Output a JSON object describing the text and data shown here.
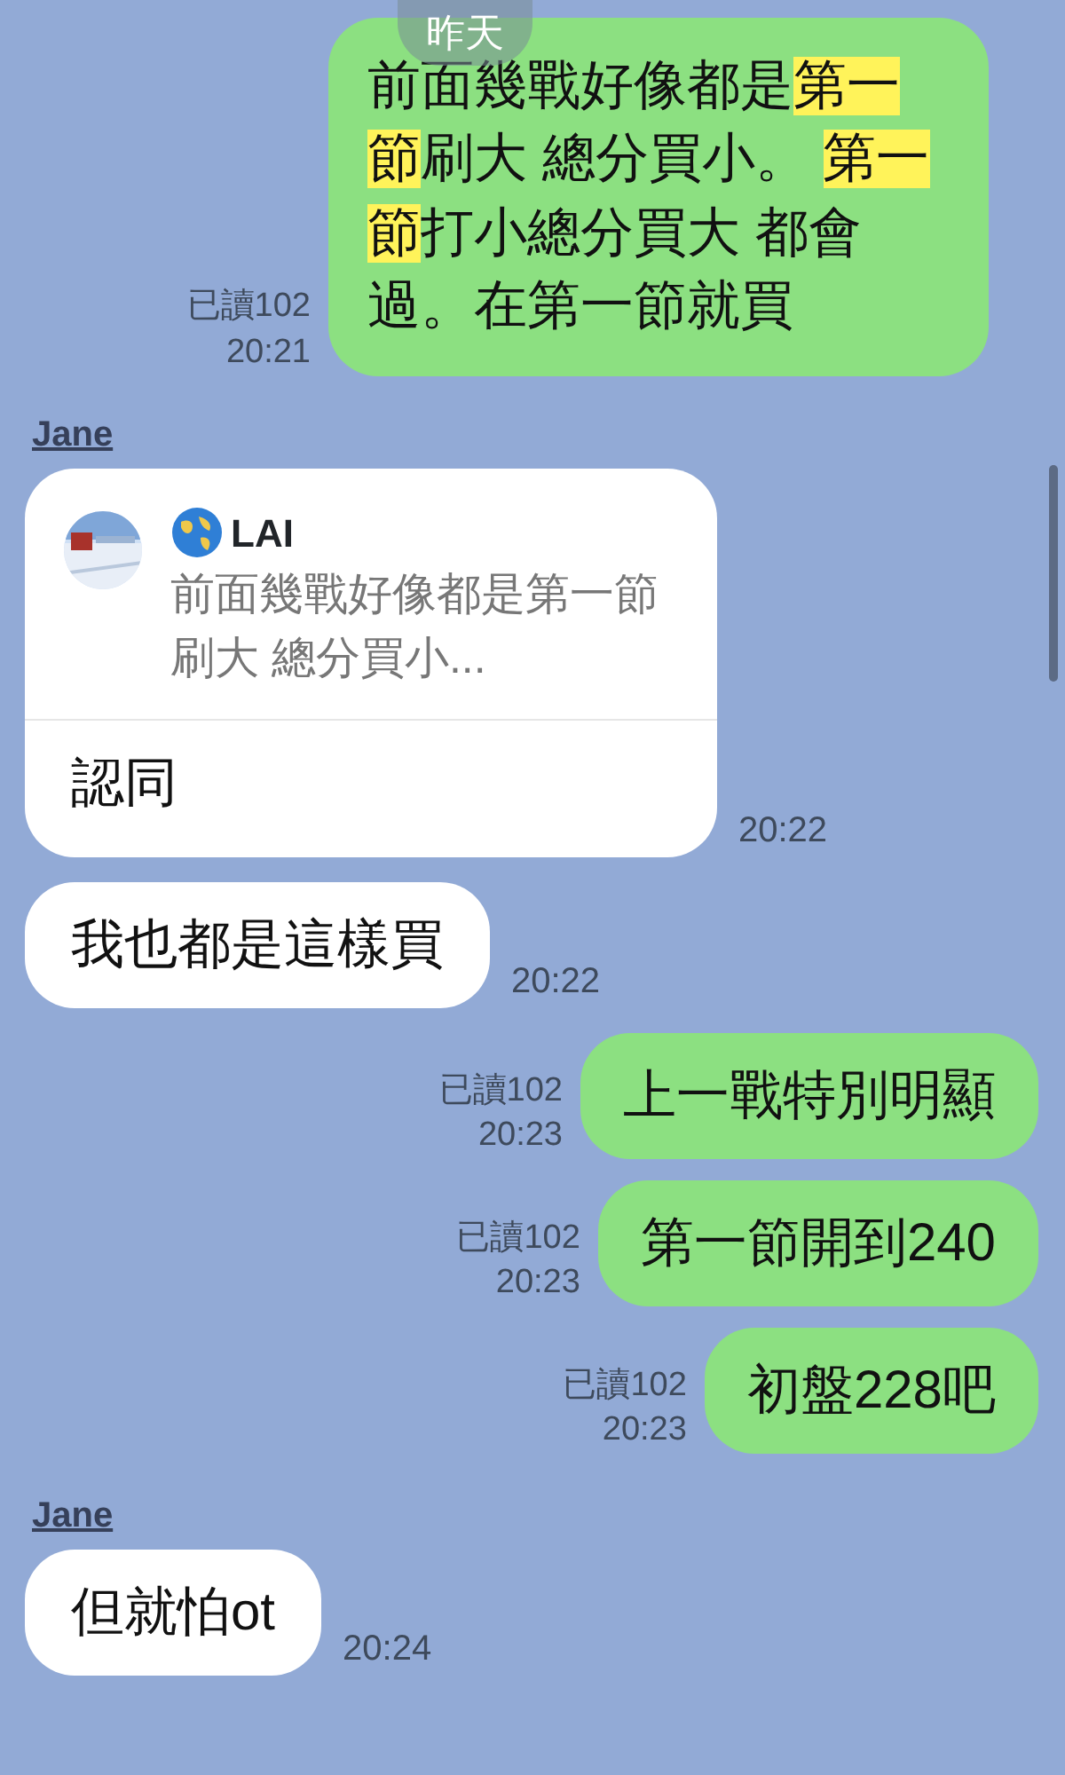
{
  "date_label": "昨天",
  "messages": [
    {
      "kind": "outgoing",
      "segments": [
        {
          "text": "前面幾戰好像都是",
          "highlighted": false
        },
        {
          "text": "第一節",
          "highlighted": true
        },
        {
          "text": "刷大 總分買小。 ",
          "highlighted": false
        },
        {
          "text": "第一節",
          "highlighted": true
        },
        {
          "text": "打小總分買大 都會過。在第一節就買",
          "highlighted": false
        }
      ],
      "read": "已讀102",
      "time": "20:21"
    },
    {
      "kind": "reply",
      "sender": "Jane",
      "quote_author": "LAI",
      "quote_text": "前面幾戰好像都是第一節刷大 總分買小...",
      "text": "認同",
      "time": "20:22"
    },
    {
      "kind": "incoming",
      "text": "我也都是這樣買",
      "time": "20:22"
    },
    {
      "kind": "outgoing",
      "segments": [
        {
          "text": "上一戰特別明顯",
          "highlighted": false
        }
      ],
      "read": "已讀102",
      "time": "20:23"
    },
    {
      "kind": "outgoing",
      "segments": [
        {
          "text": "第一節開到240",
          "highlighted": false
        }
      ],
      "read": "已讀102",
      "time": "20:23"
    },
    {
      "kind": "outgoing",
      "segments": [
        {
          "text": "初盤228吧",
          "highlighted": false
        }
      ],
      "read": "已讀102",
      "time": "20:23"
    },
    {
      "kind": "incoming",
      "sender": "Jane",
      "text": "但就怕ot",
      "time": "20:24"
    }
  ]
}
